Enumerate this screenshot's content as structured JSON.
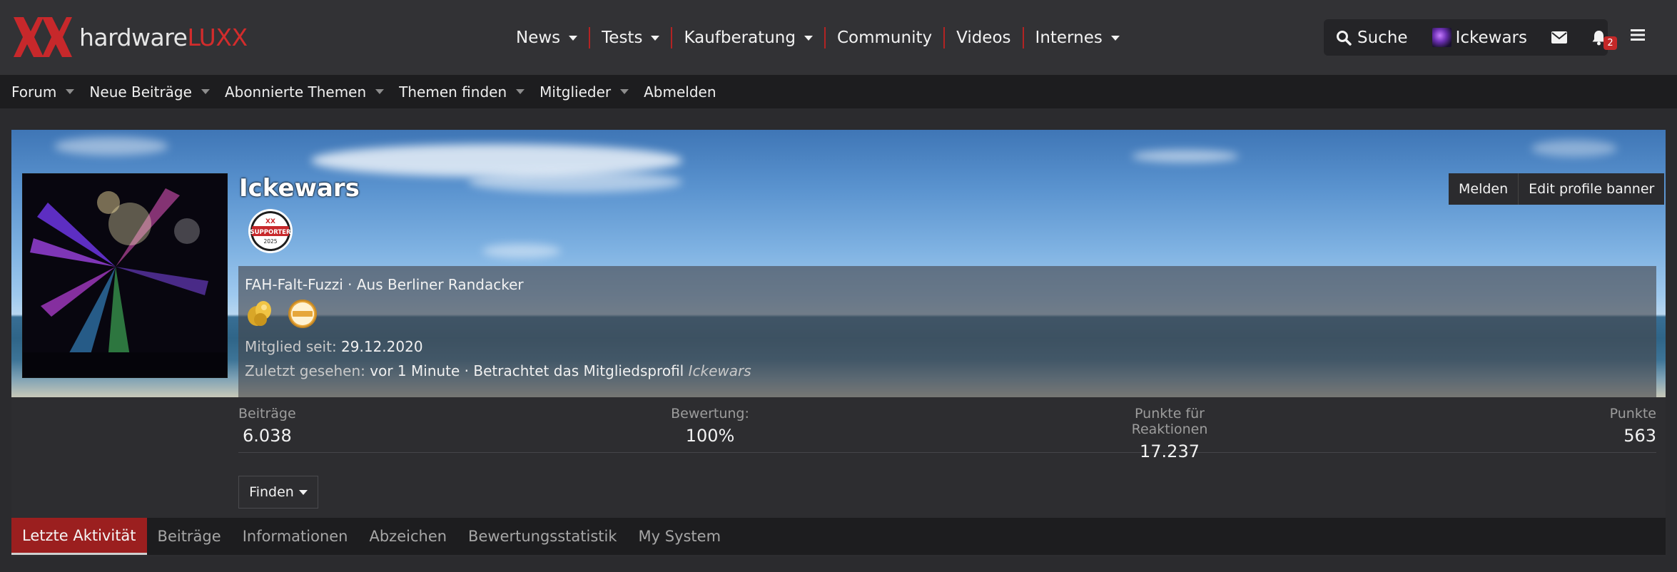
{
  "header": {
    "logo": {
      "text_white": "hardware",
      "text_red": "LUXX"
    },
    "nav": [
      {
        "label": "News",
        "dropdown": true
      },
      {
        "label": "Tests",
        "dropdown": true
      },
      {
        "label": "Kaufberatung",
        "dropdown": true
      },
      {
        "label": "Community",
        "dropdown": false
      },
      {
        "label": "Videos",
        "dropdown": false
      },
      {
        "label": "Internes",
        "dropdown": true
      }
    ],
    "search_label": "Suche",
    "username": "Ickewars",
    "alerts_count": "2"
  },
  "subnav": [
    {
      "label": "Forum",
      "dropdown": true
    },
    {
      "label": "Neue Beiträge",
      "dropdown": true
    },
    {
      "label": "Abonnierte Themen",
      "dropdown": true
    },
    {
      "label": "Themen finden",
      "dropdown": true
    },
    {
      "label": "Mitglieder",
      "dropdown": true
    },
    {
      "label": "Abmelden",
      "dropdown": false
    }
  ],
  "profile": {
    "name": "Ickewars",
    "supporter_badge": {
      "top": "XX",
      "middle": "SUPPORTER",
      "year": "2025"
    },
    "actions": {
      "report": "Melden",
      "edit_banner": "Edit profile banner"
    },
    "tagline": "FAH-Falt-Fuzzi · Aus Berliner Randacker",
    "member_since_label": "Mitglied seit:",
    "member_since_value": "29.12.2020",
    "last_seen_label": "Zuletzt gesehen:",
    "last_seen_value": "vor 1 Minute · Betrachtet das Mitgliedsprofil",
    "last_seen_target": "Ickewars",
    "stats": [
      {
        "label": "Beiträge",
        "value": "6.038"
      },
      {
        "label": "Bewertung:",
        "value": "100%"
      },
      {
        "label": "Punkte für Reaktionen",
        "value": "17.237"
      },
      {
        "label": "Punkte",
        "value": "563"
      }
    ],
    "find_label": "Finden",
    "tabs": [
      {
        "label": "Letzte Aktivität",
        "active": true
      },
      {
        "label": "Beiträge",
        "active": false
      },
      {
        "label": "Informationen",
        "active": false
      },
      {
        "label": "Abzeichen",
        "active": false
      },
      {
        "label": "Bewertungsstatistik",
        "active": false
      },
      {
        "label": "My System",
        "active": false
      }
    ]
  },
  "colors": {
    "accent": "#b32323",
    "active_tab": "#9b1f1f",
    "background": "#2b2b2e"
  }
}
